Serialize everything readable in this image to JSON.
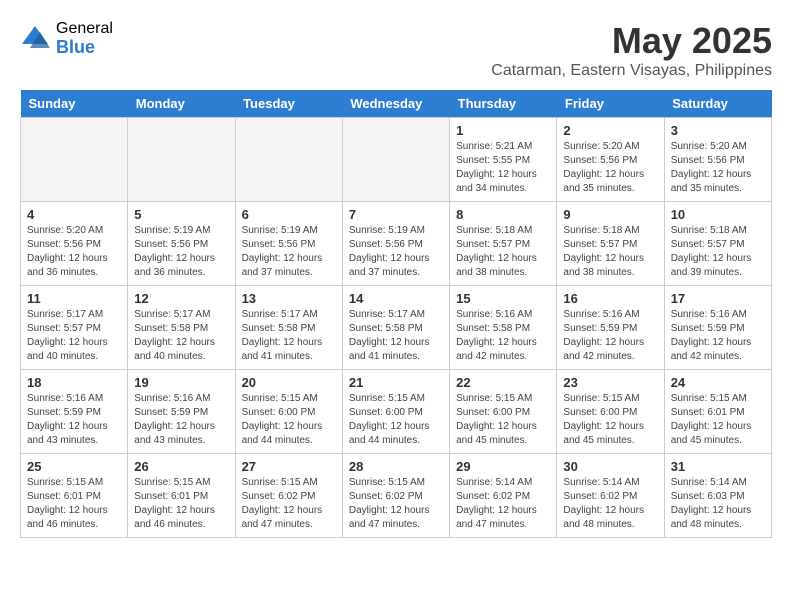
{
  "header": {
    "logo_general": "General",
    "logo_blue": "Blue",
    "month_year": "May 2025",
    "location": "Catarman, Eastern Visayas, Philippines"
  },
  "calendar": {
    "days_of_week": [
      "Sunday",
      "Monday",
      "Tuesday",
      "Wednesday",
      "Thursday",
      "Friday",
      "Saturday"
    ],
    "weeks": [
      [
        {
          "day": "",
          "info": ""
        },
        {
          "day": "",
          "info": ""
        },
        {
          "day": "",
          "info": ""
        },
        {
          "day": "",
          "info": ""
        },
        {
          "day": "1",
          "info": "Sunrise: 5:21 AM\nSunset: 5:55 PM\nDaylight: 12 hours\nand 34 minutes."
        },
        {
          "day": "2",
          "info": "Sunrise: 5:20 AM\nSunset: 5:56 PM\nDaylight: 12 hours\nand 35 minutes."
        },
        {
          "day": "3",
          "info": "Sunrise: 5:20 AM\nSunset: 5:56 PM\nDaylight: 12 hours\nand 35 minutes."
        }
      ],
      [
        {
          "day": "4",
          "info": "Sunrise: 5:20 AM\nSunset: 5:56 PM\nDaylight: 12 hours\nand 36 minutes."
        },
        {
          "day": "5",
          "info": "Sunrise: 5:19 AM\nSunset: 5:56 PM\nDaylight: 12 hours\nand 36 minutes."
        },
        {
          "day": "6",
          "info": "Sunrise: 5:19 AM\nSunset: 5:56 PM\nDaylight: 12 hours\nand 37 minutes."
        },
        {
          "day": "7",
          "info": "Sunrise: 5:19 AM\nSunset: 5:56 PM\nDaylight: 12 hours\nand 37 minutes."
        },
        {
          "day": "8",
          "info": "Sunrise: 5:18 AM\nSunset: 5:57 PM\nDaylight: 12 hours\nand 38 minutes."
        },
        {
          "day": "9",
          "info": "Sunrise: 5:18 AM\nSunset: 5:57 PM\nDaylight: 12 hours\nand 38 minutes."
        },
        {
          "day": "10",
          "info": "Sunrise: 5:18 AM\nSunset: 5:57 PM\nDaylight: 12 hours\nand 39 minutes."
        }
      ],
      [
        {
          "day": "11",
          "info": "Sunrise: 5:17 AM\nSunset: 5:57 PM\nDaylight: 12 hours\nand 40 minutes."
        },
        {
          "day": "12",
          "info": "Sunrise: 5:17 AM\nSunset: 5:58 PM\nDaylight: 12 hours\nand 40 minutes."
        },
        {
          "day": "13",
          "info": "Sunrise: 5:17 AM\nSunset: 5:58 PM\nDaylight: 12 hours\nand 41 minutes."
        },
        {
          "day": "14",
          "info": "Sunrise: 5:17 AM\nSunset: 5:58 PM\nDaylight: 12 hours\nand 41 minutes."
        },
        {
          "day": "15",
          "info": "Sunrise: 5:16 AM\nSunset: 5:58 PM\nDaylight: 12 hours\nand 42 minutes."
        },
        {
          "day": "16",
          "info": "Sunrise: 5:16 AM\nSunset: 5:59 PM\nDaylight: 12 hours\nand 42 minutes."
        },
        {
          "day": "17",
          "info": "Sunrise: 5:16 AM\nSunset: 5:59 PM\nDaylight: 12 hours\nand 42 minutes."
        }
      ],
      [
        {
          "day": "18",
          "info": "Sunrise: 5:16 AM\nSunset: 5:59 PM\nDaylight: 12 hours\nand 43 minutes."
        },
        {
          "day": "19",
          "info": "Sunrise: 5:16 AM\nSunset: 5:59 PM\nDaylight: 12 hours\nand 43 minutes."
        },
        {
          "day": "20",
          "info": "Sunrise: 5:15 AM\nSunset: 6:00 PM\nDaylight: 12 hours\nand 44 minutes."
        },
        {
          "day": "21",
          "info": "Sunrise: 5:15 AM\nSunset: 6:00 PM\nDaylight: 12 hours\nand 44 minutes."
        },
        {
          "day": "22",
          "info": "Sunrise: 5:15 AM\nSunset: 6:00 PM\nDaylight: 12 hours\nand 45 minutes."
        },
        {
          "day": "23",
          "info": "Sunrise: 5:15 AM\nSunset: 6:00 PM\nDaylight: 12 hours\nand 45 minutes."
        },
        {
          "day": "24",
          "info": "Sunrise: 5:15 AM\nSunset: 6:01 PM\nDaylight: 12 hours\nand 45 minutes."
        }
      ],
      [
        {
          "day": "25",
          "info": "Sunrise: 5:15 AM\nSunset: 6:01 PM\nDaylight: 12 hours\nand 46 minutes."
        },
        {
          "day": "26",
          "info": "Sunrise: 5:15 AM\nSunset: 6:01 PM\nDaylight: 12 hours\nand 46 minutes."
        },
        {
          "day": "27",
          "info": "Sunrise: 5:15 AM\nSunset: 6:02 PM\nDaylight: 12 hours\nand 47 minutes."
        },
        {
          "day": "28",
          "info": "Sunrise: 5:15 AM\nSunset: 6:02 PM\nDaylight: 12 hours\nand 47 minutes."
        },
        {
          "day": "29",
          "info": "Sunrise: 5:14 AM\nSunset: 6:02 PM\nDaylight: 12 hours\nand 47 minutes."
        },
        {
          "day": "30",
          "info": "Sunrise: 5:14 AM\nSunset: 6:02 PM\nDaylight: 12 hours\nand 48 minutes."
        },
        {
          "day": "31",
          "info": "Sunrise: 5:14 AM\nSunset: 6:03 PM\nDaylight: 12 hours\nand 48 minutes."
        }
      ]
    ]
  }
}
